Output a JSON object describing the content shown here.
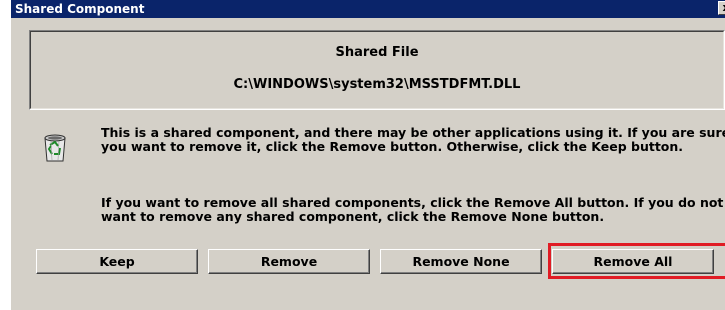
{
  "window": {
    "title": "Shared Component",
    "close_glyph": "x"
  },
  "shared_file": {
    "heading": "Shared File",
    "path": "C:\\WINDOWS\\system32\\MSSTDFMT.DLL"
  },
  "message": {
    "icon": "recycle-bin-icon",
    "paragraph1": "This is a shared component, and there may be other applications using it.  If you are sure you want to remove it, click the Remove button.  Otherwise, click the Keep button.",
    "paragraph2": "If you want to remove all shared components, click the Remove All button.  If you do not want to remove any shared component, click the Remove None button."
  },
  "buttons": {
    "keep": "Keep",
    "remove": "Remove",
    "remove_none": "Remove None",
    "remove_all": "Remove All"
  },
  "colors": {
    "title_bar": "#0a246a",
    "dialog_face": "#d4d0c8",
    "highlight": "#e01b24"
  }
}
